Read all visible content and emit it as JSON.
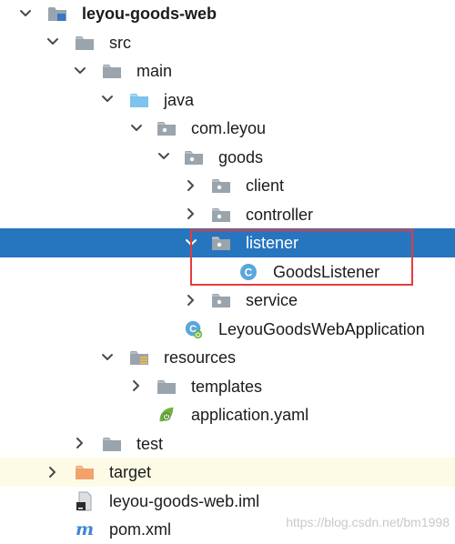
{
  "tree": [
    {
      "name": "tree-row-project-root",
      "label": "leyou-goods-web",
      "chevron": "down",
      "icon": "module-icon",
      "bold": true,
      "state": "normal"
    },
    {
      "name": "tree-row-src",
      "label": "src",
      "chevron": "down",
      "icon": "folder-icon",
      "state": "normal"
    },
    {
      "name": "tree-row-main",
      "label": "main",
      "chevron": "down",
      "icon": "folder-icon",
      "state": "normal"
    },
    {
      "name": "tree-row-java",
      "label": "java",
      "chevron": "down",
      "icon": "source-root-icon",
      "state": "normal"
    },
    {
      "name": "tree-row-com-leyou",
      "label": "com.leyou",
      "chevron": "down",
      "icon": "package-icon",
      "state": "normal"
    },
    {
      "name": "tree-row-goods",
      "label": "goods",
      "chevron": "down",
      "icon": "package-icon",
      "state": "normal"
    },
    {
      "name": "tree-row-client",
      "label": "client",
      "chevron": "right",
      "icon": "package-icon",
      "state": "normal"
    },
    {
      "name": "tree-row-controller",
      "label": "controller",
      "chevron": "right",
      "icon": "package-icon",
      "state": "normal"
    },
    {
      "name": "tree-row-listener",
      "label": "listener",
      "chevron": "down",
      "icon": "package-icon",
      "state": "selected"
    },
    {
      "name": "tree-row-goods-listener",
      "label": "GoodsListener",
      "chevron": "none",
      "icon": "class-icon",
      "state": "normal"
    },
    {
      "name": "tree-row-service",
      "label": "service",
      "chevron": "right",
      "icon": "package-icon",
      "state": "normal"
    },
    {
      "name": "tree-row-application-class",
      "label": "LeyouGoodsWebApplication",
      "chevron": "none",
      "icon": "spring-boot-class-icon",
      "state": "normal"
    },
    {
      "name": "tree-row-resources",
      "label": "resources",
      "chevron": "down",
      "icon": "resources-folder-icon",
      "state": "normal"
    },
    {
      "name": "tree-row-templates",
      "label": "templates",
      "chevron": "right",
      "icon": "folder-icon",
      "state": "normal"
    },
    {
      "name": "tree-row-application-yaml",
      "label": "application.yaml",
      "chevron": "none",
      "icon": "spring-yaml-icon",
      "state": "normal"
    },
    {
      "name": "tree-row-test",
      "label": "test",
      "chevron": "right",
      "icon": "folder-icon",
      "state": "normal"
    },
    {
      "name": "tree-row-target",
      "label": "target",
      "chevron": "right",
      "icon": "excluded-folder-icon",
      "state": "excluded"
    },
    {
      "name": "tree-row-iml",
      "label": "leyou-goods-web.iml",
      "chevron": "none",
      "icon": "iml-file-icon",
      "state": "normal"
    },
    {
      "name": "tree-row-pom",
      "label": "pom.xml",
      "chevron": "none",
      "icon": "maven-icon",
      "state": "normal"
    }
  ],
  "watermark": "https://blog.csdn.net/bm1998",
  "colors": {
    "selection": "#2675bf",
    "excluded_row": "#fdfbe6",
    "highlight_box": "#e53b3b",
    "folder": "#9aa4ad",
    "source_folder": "#7cc3ee",
    "excluded_folder": "#f2a36c",
    "class_icon": "#3d9ad6"
  }
}
